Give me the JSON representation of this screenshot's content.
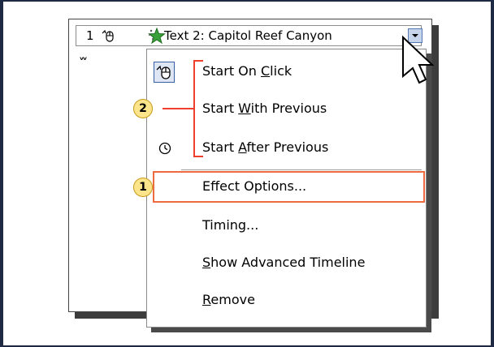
{
  "animation_row": {
    "sequence_number": "1",
    "effect_title": "Text 2: Capitol Reef Canyon"
  },
  "menu": {
    "items": [
      {
        "label_pre": "Start On ",
        "label_ul": "C",
        "label_post": "lick",
        "icon": "mouse-icon",
        "selected": true
      },
      {
        "label_pre": "Start ",
        "label_ul": "W",
        "label_post": "ith Previous",
        "icon": "",
        "selected": false
      },
      {
        "label_pre": "Start ",
        "label_ul": "A",
        "label_post": "fter Previous",
        "icon": "clock-icon",
        "selected": false
      },
      {
        "label_pre": "",
        "label_ul": "",
        "label_post": "Effect Options...",
        "icon": "",
        "selected": false
      },
      {
        "label_pre": "",
        "label_ul": "",
        "label_post": "Timing...",
        "icon": "",
        "selected": false
      },
      {
        "label_pre": "",
        "label_ul": "S",
        "label_post": "how Advanced Timeline",
        "icon": "",
        "selected": false
      },
      {
        "label_pre": "",
        "label_ul": "R",
        "label_post": "emove",
        "icon": "",
        "selected": false
      }
    ]
  },
  "callouts": {
    "one": "1",
    "two": "2"
  },
  "colors": {
    "callout_fill": "#fbe48a",
    "highlight_orange": "#ee6b3f",
    "bracket_red": "#ee3f2f",
    "frame_navy": "#1e2a44"
  }
}
